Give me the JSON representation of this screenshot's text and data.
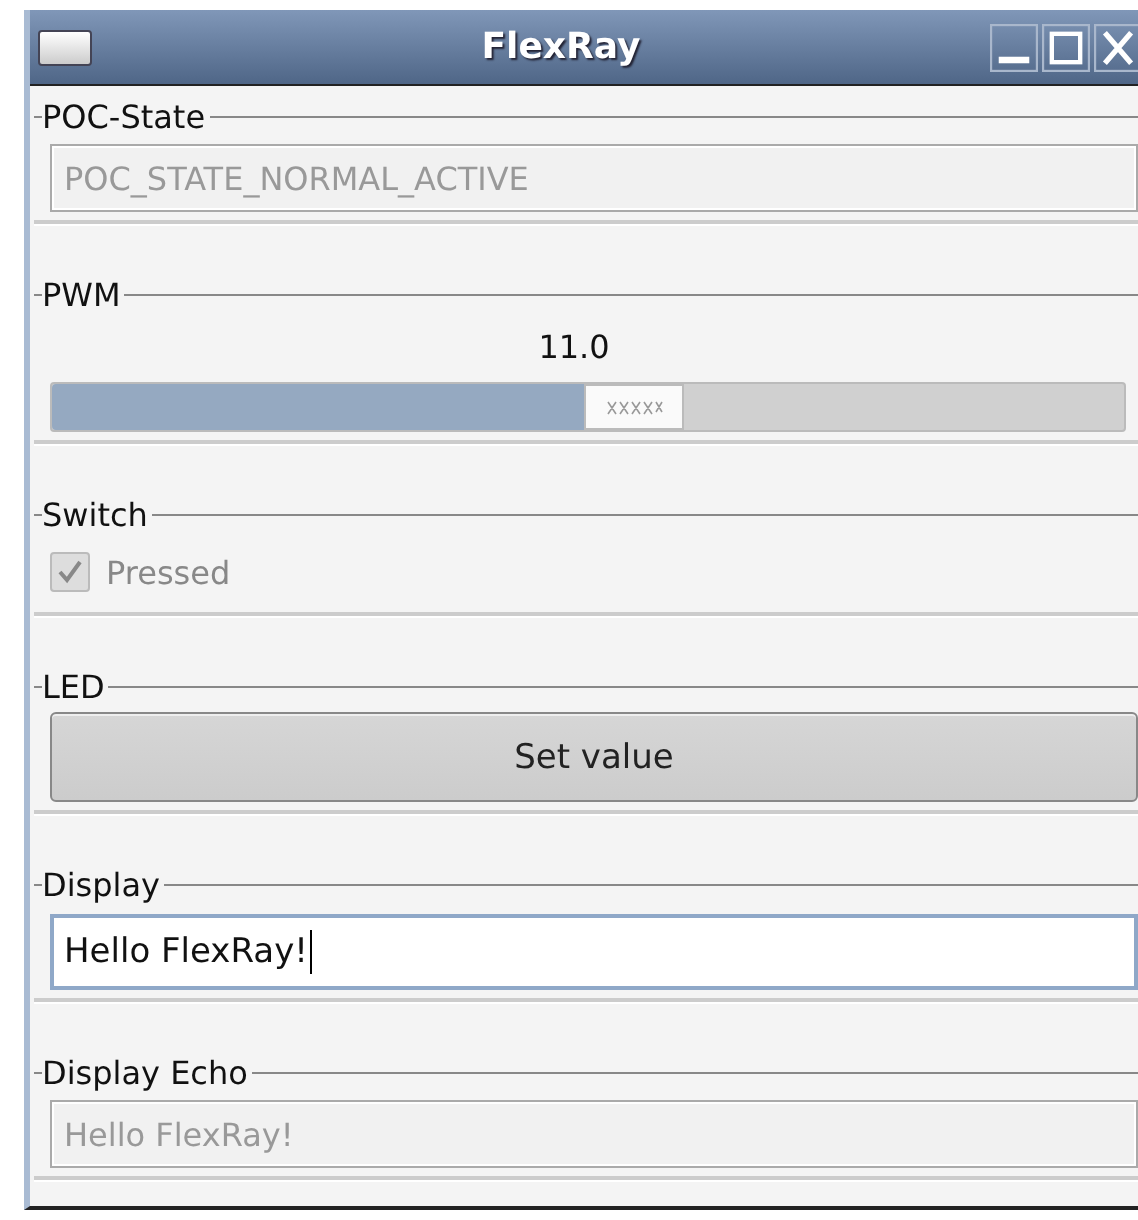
{
  "window": {
    "title": "FlexRay"
  },
  "groups": [
    {
      "title": "POC-State",
      "kind": "readonly_field",
      "value": "POC_STATE_NORMAL_ACTIVE",
      "disabled": true
    },
    {
      "title": "PWM",
      "kind": "slider",
      "reading": "11.0",
      "level": 0.55
    },
    {
      "title": "Switch",
      "kind": "checkbox",
      "label": "Pressed",
      "checked": true,
      "disabled": true
    },
    {
      "title": "LED",
      "kind": "button",
      "label": "Set value"
    },
    {
      "title": "Display",
      "kind": "text_input",
      "value": "Hello FlexRay!"
    },
    {
      "title": "Display Echo",
      "kind": "readonly_field",
      "value": "Hello FlexRay!",
      "disabled": true
    }
  ]
}
